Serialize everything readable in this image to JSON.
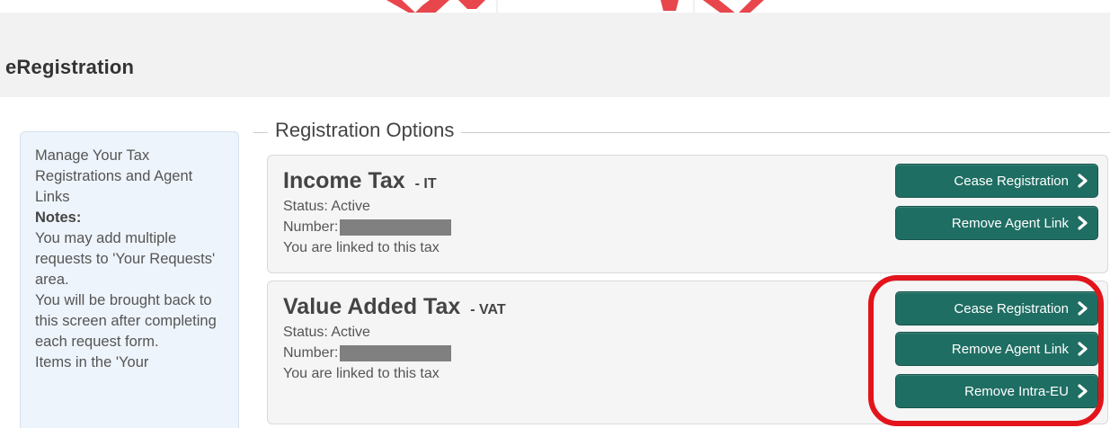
{
  "header": {
    "title": "eRegistration"
  },
  "sidebar": {
    "intro": "Manage Your Tax Registrations and Agent Links",
    "notes_label": "Notes:",
    "note_1": "You may add multiple requests to 'Your Requests' area.",
    "note_2": "You will be brought back to this screen after completing each request form.",
    "note_3": "Items in the 'Your"
  },
  "options": {
    "legend": "Registration Options",
    "status_label": "Status: Active",
    "number_label": "Number:",
    "linked_text": "You are linked to this tax",
    "taxes": [
      {
        "name": "Income Tax",
        "code": "- IT",
        "buttons": [
          "Cease Registration",
          "Remove Agent Link"
        ]
      },
      {
        "name": "Value Added Tax",
        "code": "- VAT",
        "buttons": [
          "Cease Registration",
          "Remove Agent Link",
          "Remove Intra-EU"
        ]
      }
    ]
  },
  "colors": {
    "button_bg": "#1f6e63",
    "highlight": "#e3141b",
    "header_bg": "#f2f2f2"
  }
}
